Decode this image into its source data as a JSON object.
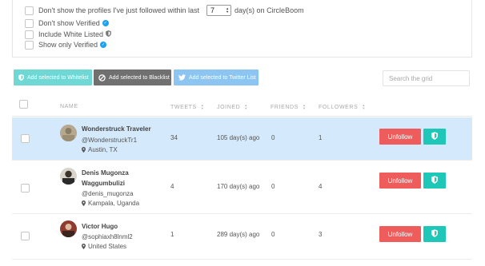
{
  "filters": {
    "hide_followed_prefix": "Don't show the profiles I've just followed within last",
    "days_value": "7",
    "hide_followed_suffix": "day(s) on CircleBoom",
    "dont_show_verified": "Don't show Verified",
    "include_white_listed": "Include White Listed",
    "show_only_verified": "Show only Verified"
  },
  "toolbar": {
    "whitelist_label": "Add selected to Whitelist",
    "blacklist_label": "Add selected to Blacklist",
    "twitter_list_label": "Add selected to Twitter List",
    "search_placeholder": "Search the grid"
  },
  "table": {
    "columns": {
      "name": "NAME",
      "tweets": "TWEETS",
      "joined": "JOINED",
      "friends": "FRIENDS",
      "followers": "FOLLOWERS"
    },
    "rows": [
      {
        "name": "Wonderstruck Traveler",
        "handle": "@WonderstruckTr1",
        "location": "Austin, TX",
        "tweets": "34",
        "joined": "105 day(s) ago",
        "friends": "0",
        "followers": "1",
        "unfollow_label": "Unfollow",
        "selected": true
      },
      {
        "name_line1": "Denis Mugonza",
        "name_line2": "Waggumbulizi",
        "handle": "@denis_mugonza",
        "location": "Kampala, Uganda",
        "tweets": "4",
        "joined": "170 day(s) ago",
        "friends": "0",
        "followers": "4",
        "unfollow_label": "Unfollow",
        "selected": false
      },
      {
        "name": "Victor Hugo",
        "handle": "@sophiaxh8lnml2",
        "location": "United States",
        "tweets": "1",
        "joined": "289 day(s) ago",
        "friends": "0",
        "followers": "3",
        "unfollow_label": "Unfollow",
        "selected": false
      }
    ]
  },
  "colors": {
    "selected_row": "#d4e9fb",
    "unfollow": "#ef5c5c",
    "whitelist_action": "#1fc7b8",
    "whitelist_button": "#6fd8d4",
    "blacklist_button": "#707070",
    "twitter_button": "#8cc5f2",
    "verified_badge": "#1da1f2"
  },
  "icons": {
    "verified": "verified-badge-icon",
    "shield": "shield-icon",
    "ban": "ban-icon",
    "twitter": "twitter-bird-icon",
    "pin": "location-pin-icon",
    "sort": "sort-arrows-icon"
  }
}
